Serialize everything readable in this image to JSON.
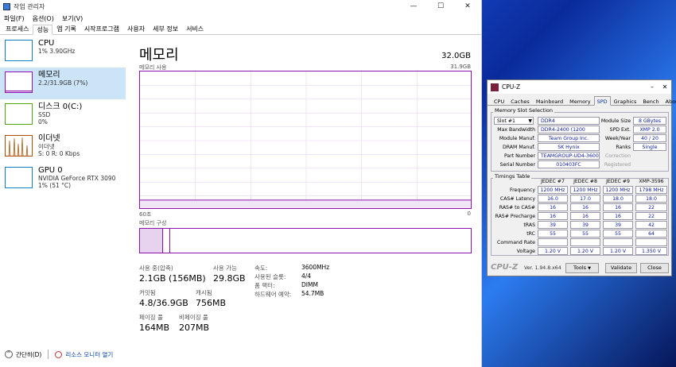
{
  "taskmgr": {
    "title": "작업 관리자",
    "window_buttons": {
      "minimize": "—",
      "maximize": "☐",
      "close": "✕"
    },
    "menu": [
      "파일(F)",
      "옵션(O)",
      "보기(V)"
    ],
    "tabs": [
      "프로세스",
      "성능",
      "앱 기록",
      "시작프로그램",
      "사용자",
      "세부 정보",
      "서비스"
    ],
    "active_tab": "성능",
    "sidebar": [
      {
        "title": "CPU",
        "sub1": "1% 3.90GHz",
        "sub2": "",
        "sub3": "",
        "color": "#117dbb"
      },
      {
        "title": "메모리",
        "sub1": "2.2/31.9GB (7%)",
        "sub2": "",
        "sub3": "",
        "color": "#8b12ae"
      },
      {
        "title": "디스크 0(C:)",
        "sub1": "SSD",
        "sub2": "0%",
        "sub3": "",
        "color": "#4da60c"
      },
      {
        "title": "이더넷",
        "sub1": "이더넷",
        "sub2": "S: 0 R: 0 Kbps",
        "sub3": "",
        "color": "#a74f01"
      },
      {
        "title": "GPU 0",
        "sub1": "NVIDIA GeForce RTX 3090",
        "sub2": "1% (51 °C)",
        "sub3": "",
        "color": "#117dbb"
      }
    ],
    "memory": {
      "heading": "메모리",
      "total": "32.0GB",
      "usage_label": "메모리 사용",
      "usage_max": "31.9GB",
      "time_left": "60초",
      "time_right": "0",
      "composition_label": "메모리 구성",
      "usage_fraction": 0.07,
      "stats": {
        "in_use_label": "사용 중(압축)",
        "in_use": "2.1GB (156MB)",
        "available_label": "사용 가능",
        "available": "29.8GB",
        "committed_label": "커밋됨",
        "committed": "4.8/36.9GB",
        "cached_label": "캐시됨",
        "cached": "756MB",
        "paged_label": "페이징 풀",
        "paged": "164MB",
        "nonpaged_label": "비페이징 풀",
        "nonpaged": "207MB",
        "speed_label": "속도:",
        "speed": "3600MHz",
        "slots_label": "사용된 슬롯:",
        "slots": "4/4",
        "form_label": "폼 팩터:",
        "form": "DIMM",
        "reserved_label": "하드웨어 예약:",
        "reserved": "54.7MB"
      }
    },
    "footer": {
      "collapse": "간단히(D)",
      "monitor": "리소스 모니터 열기"
    }
  },
  "cpuz": {
    "title": "CPU-Z",
    "tabs": [
      "CPU",
      "Caches",
      "Mainboard",
      "Memory",
      "SPD",
      "Graphics",
      "Bench",
      "About"
    ],
    "active_tab": "SPD",
    "slot_group": "Memory Slot Selection",
    "slot_value": "Slot #1",
    "slot_type": "DDR4",
    "module_size_label": "Module Size",
    "module_size": "8 GBytes",
    "max_bw_label": "Max Bandwidth",
    "max_bw": "DDR4-2400 (1200 MHz)",
    "spd_ext_label": "SPD Ext.",
    "spd_ext": "XMP 2.0",
    "manuf_label": "Module Manuf.",
    "manuf": "Team Group Inc.",
    "week_label": "Week/Year",
    "week": "40 / 20",
    "dram_label": "DRAM Manuf.",
    "dram": "SK Hynix",
    "ranks_label": "Ranks",
    "ranks": "Single",
    "part_label": "Part Number",
    "part": "TEAMGROUP-UD4-3600",
    "correction_label": "Correction",
    "serial_label": "Serial Number",
    "serial": "010403FC",
    "registered_label": "Registered",
    "timings_group": "Timings Table",
    "timing_cols": [
      "JEDEC #7",
      "JEDEC #8",
      "JEDEC #9",
      "XMP-3596"
    ],
    "timing_rows": [
      {
        "label": "Frequency",
        "values": [
          "1200 MHz",
          "1200 MHz",
          "1200 MHz",
          "1798 MHz"
        ]
      },
      {
        "label": "CAS# Latency",
        "values": [
          "16.0",
          "17.0",
          "18.0",
          "18.0"
        ]
      },
      {
        "label": "RAS# to CAS#",
        "values": [
          "16",
          "16",
          "16",
          "22"
        ]
      },
      {
        "label": "RAS# Precharge",
        "values": [
          "16",
          "16",
          "16",
          "22"
        ]
      },
      {
        "label": "tRAS",
        "values": [
          "39",
          "39",
          "39",
          "42"
        ]
      },
      {
        "label": "tRC",
        "values": [
          "55",
          "55",
          "55",
          "64"
        ]
      },
      {
        "label": "Command Rate",
        "values": [
          "",
          "",
          "",
          ""
        ]
      },
      {
        "label": "Voltage",
        "values": [
          "1.20 V",
          "1.20 V",
          "1.20 V",
          "1.350 V"
        ]
      }
    ],
    "logo": "CPU-Z",
    "version": "Ver. 1.94.8.x64",
    "tools": "Tools",
    "validate": "Validate",
    "close": "Close"
  }
}
